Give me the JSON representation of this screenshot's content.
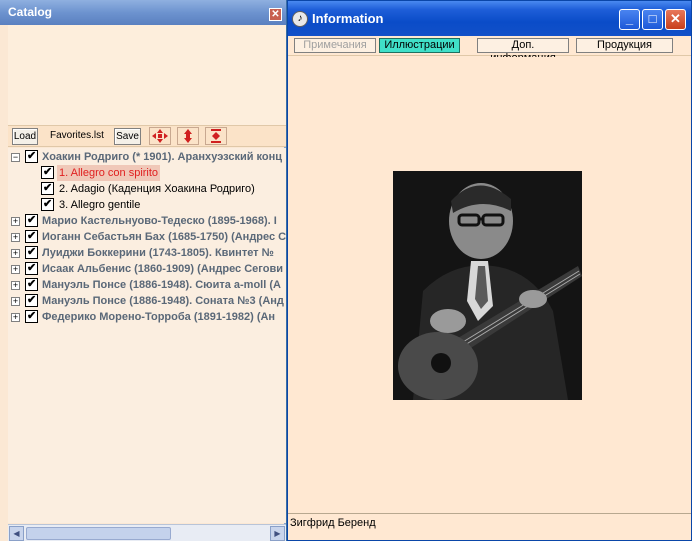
{
  "catalog": {
    "title": "Catalog",
    "toolbar": {
      "load_label": "Load",
      "file_name": "Favorites.lst",
      "save_label": "Save"
    },
    "tree": [
      {
        "label": "Хоакин Родриго (* 1901). Аранхуэзский конц",
        "expanded": true,
        "checked": true,
        "children": [
          {
            "label": "1. Allegro con spirito",
            "checked": true,
            "selected": true
          },
          {
            "label": "2. Adagio (Каденция Хоакина Родриго)",
            "checked": true
          },
          {
            "label": "3. Allegro gentile",
            "checked": true
          }
        ]
      },
      {
        "label": "Марио Кастельнуово-Тедеско (1895-1968). I",
        "checked": true
      },
      {
        "label": "Иоганн Себастьян Бах (1685-1750) (Андрес С",
        "checked": true
      },
      {
        "label": "Луиджи Боккерини (1743-1805). Квинтет №",
        "checked": true
      },
      {
        "label": "Исаак Альбенис (1860-1909) (Андрес Сегови",
        "checked": true
      },
      {
        "label": "Мануэль Понсе (1886-1948). Сюита a-moll (А",
        "checked": true
      },
      {
        "label": "Мануэль Понсе (1886-1948). Соната №3 (Анд",
        "checked": true
      },
      {
        "label": "Федерико Морено-Торроба (1891-1982) (Ан",
        "checked": true
      }
    ]
  },
  "info": {
    "title": "Information",
    "tabs": [
      {
        "label": "Примечания",
        "state": "disabled"
      },
      {
        "label": "Иллюстрации",
        "state": "active"
      },
      {
        "label": "Доп. информация",
        "state": "normal"
      },
      {
        "label": "Продукция",
        "state": "normal"
      }
    ],
    "caption": "Зигфрид Беренд"
  },
  "colors": {
    "panel_bg": "#fbe8d4",
    "active_tab": "#40e0c8",
    "selected_text": "#e02020",
    "xp_title": "#0a4cc8"
  }
}
